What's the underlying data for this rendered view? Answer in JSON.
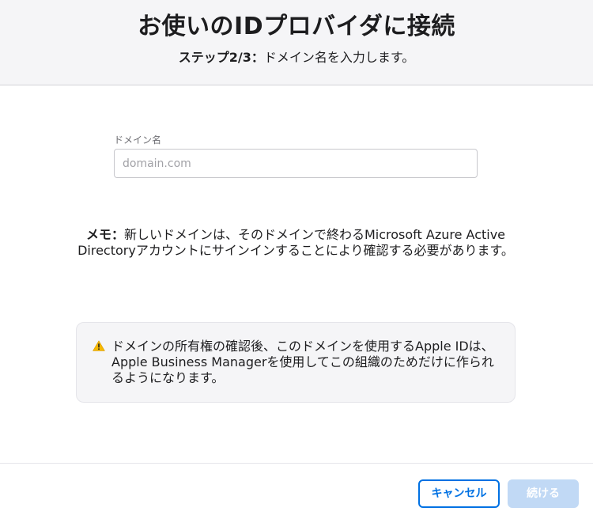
{
  "header": {
    "title": "お使いのIDプロバイダに接続",
    "step_label": "ステップ2/3：",
    "step_text": "ドメイン名を入力します。"
  },
  "domain_field": {
    "label": "ドメイン名",
    "placeholder": "domain.com",
    "value": ""
  },
  "note": {
    "label": "メモ：",
    "text": "新しいドメインは、そのドメインで終わるMicrosoft Azure Active Directoryアカウントにサインインすることにより確認する必要があります。"
  },
  "warning": {
    "icon": "warning-icon",
    "text": "ドメインの所有権の確認後、このドメインを使用するApple IDは、Apple Business Managerを使用してこの組織のためだけに作られるようになります。"
  },
  "footer": {
    "cancel_label": "キャンセル",
    "continue_label": "続ける"
  },
  "colors": {
    "accent": "#0071e3",
    "disabled_button": "#c1d9f5",
    "warning_icon": "#f5b800",
    "header_background": "#f5f5f7"
  }
}
